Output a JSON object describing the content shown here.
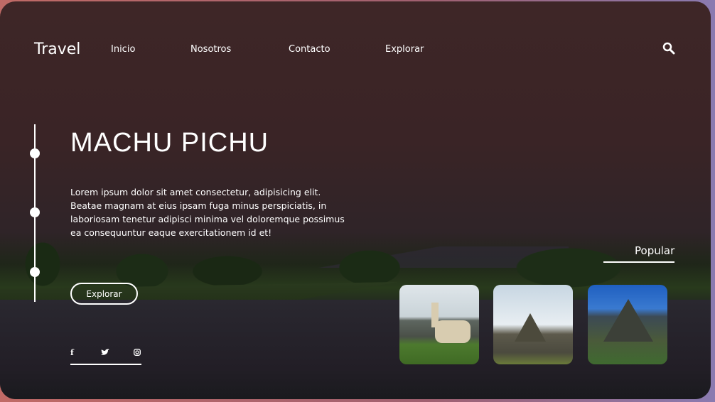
{
  "header": {
    "logo": "Travel",
    "nav": [
      "Inicio",
      "Nosotros",
      "Contacto",
      "Explorar"
    ],
    "search_icon": "search-icon"
  },
  "hero": {
    "title": "MACHU PICHU",
    "description": "Lorem ipsum dolor sit amet consectetur, adipisicing elit. Beatae magnam at eius ipsam fuga minus perspiciatis, in laboriosam tenetur adipisci minima vel doloremque possimus ea consequuntur eaque exercitationem id et!",
    "button": "Explorar"
  },
  "social": [
    "facebook-icon",
    "twitter-icon",
    "instagram-icon"
  ],
  "popular": {
    "label": "Popular",
    "cards": [
      "llama",
      "huayna-picchu-clouds",
      "machu-picchu-blue-sky"
    ]
  }
}
